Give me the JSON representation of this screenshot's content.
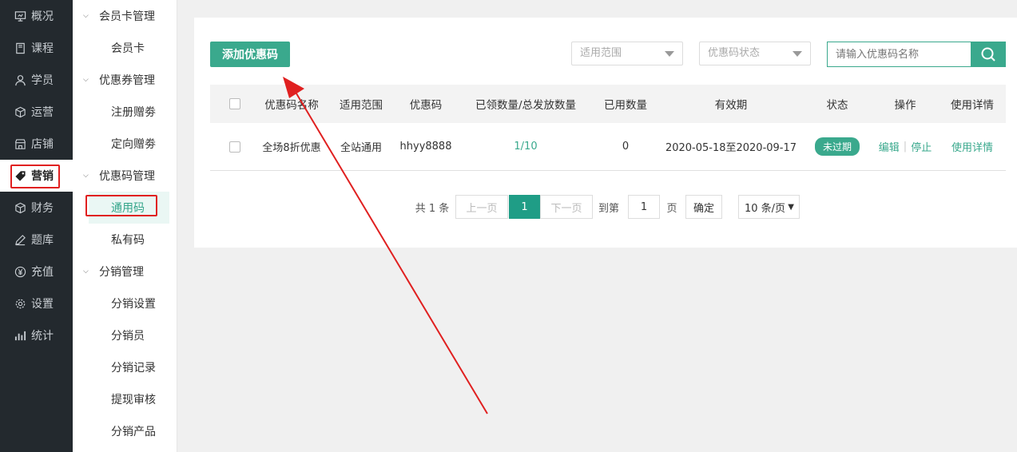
{
  "nav": {
    "items": [
      {
        "label": "概况",
        "icon": "monitor-icon"
      },
      {
        "label": "课程",
        "icon": "book-icon"
      },
      {
        "label": "学员",
        "icon": "user-icon"
      },
      {
        "label": "运营",
        "icon": "cube-icon"
      },
      {
        "label": "店铺",
        "icon": "store-icon"
      },
      {
        "label": "营销",
        "icon": "tag-icon"
      },
      {
        "label": "财务",
        "icon": "cube-icon"
      },
      {
        "label": "题库",
        "icon": "pen-icon"
      },
      {
        "label": "充值",
        "icon": "yen-icon"
      },
      {
        "label": "设置",
        "icon": "gear-icon"
      },
      {
        "label": "统计",
        "icon": "bar-chart-icon"
      }
    ],
    "active": "营销"
  },
  "subnav": {
    "groups": [
      {
        "label": "会员卡管理",
        "items": [
          "会员卡"
        ]
      },
      {
        "label": "优惠券管理",
        "items": [
          "注册赠劵",
          "定向赠劵"
        ]
      },
      {
        "label": "优惠码管理",
        "items": [
          "通用码",
          "私有码"
        ]
      },
      {
        "label": "分销管理",
        "items": [
          "分销设置",
          "分销员",
          "分销记录",
          "提现审核",
          "分销产品"
        ]
      }
    ],
    "active": "通用码"
  },
  "toolbar": {
    "add_label": "添加优惠码",
    "scope_placeholder": "适用范围",
    "status_placeholder": "优惠码状态",
    "search_placeholder": "请输入优惠码名称"
  },
  "table": {
    "headers": [
      "优惠码名称",
      "适用范围",
      "优惠码",
      "已领数量/总发放数量",
      "已用数量",
      "有效期",
      "状态",
      "操作",
      "使用详情"
    ],
    "rows": [
      {
        "name": "全场8折优惠",
        "scope": "全站通用",
        "code": "hhyy8888",
        "claimed": "1/10",
        "used": "0",
        "validity": "2020-05-18至2020-09-17",
        "status": "未过期",
        "edit": "编辑",
        "stop": "停止",
        "detail": "使用详情"
      }
    ]
  },
  "pagination": {
    "total": "共 1 条",
    "prev": "上一页",
    "current": "1",
    "next": "下一页",
    "goto": "到第",
    "page_input": "1",
    "page_unit": "页",
    "confirm": "确定",
    "page_size": "10 条/页"
  },
  "colors": {
    "accent": "#3aa98d",
    "nav_bg": "#23292e",
    "annotation": "#e02020"
  }
}
